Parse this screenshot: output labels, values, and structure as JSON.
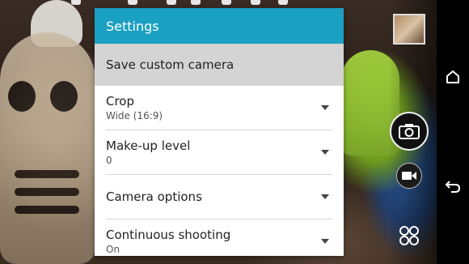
{
  "settings": {
    "title": "Settings",
    "save_custom_camera": "Save custom camera",
    "options": [
      {
        "label": "Crop",
        "value": "Wide (16:9)"
      },
      {
        "label": "Make-up level",
        "value": "0"
      },
      {
        "label": "Camera options",
        "value": ""
      },
      {
        "label": "Continuous shooting",
        "value": "On"
      }
    ]
  },
  "colors": {
    "header": "#1aa0c2",
    "save_row": "#d4d4d4"
  },
  "icons": {
    "gallery_thumbnail": "gallery-thumbnail",
    "shutter": "camera-icon",
    "video": "video-camera-icon",
    "apps": "modes-grid-icon",
    "home": "home-icon",
    "back": "back-icon"
  }
}
